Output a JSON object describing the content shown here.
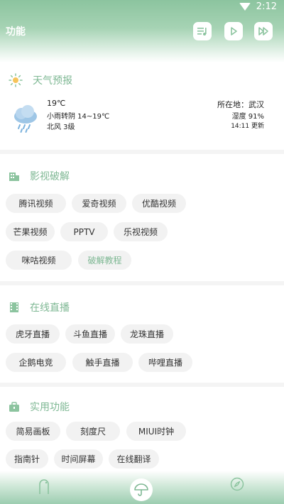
{
  "status": {
    "time": "2:12"
  },
  "header": {
    "title": "功能"
  },
  "weather": {
    "section_title": "天气预报",
    "temperature": "19℃",
    "description": "小雨转阴 14~19℃",
    "wind": "北风 3级",
    "location": "所在地：武汉",
    "humidity": "湿度 91%",
    "updated": "14:11 更新"
  },
  "video": {
    "section_title": "影视破解",
    "items": [
      "腾讯视频",
      "爱奇视频",
      "优酷视频",
      "芒果视频",
      "PPTV",
      "乐视视频",
      "咪咕视频",
      "破解教程"
    ]
  },
  "live": {
    "section_title": "在线直播",
    "items": [
      "虎牙直播",
      "斗鱼直播",
      "龙珠直播",
      "企鹅电竞",
      "触手直播",
      "哔哩直播"
    ]
  },
  "utility": {
    "section_title": "实用功能",
    "items": [
      "简易画板",
      "刻度尺",
      "MIUI时钟",
      "指南针",
      "时间屏幕",
      "在线翻译"
    ]
  },
  "colors": {
    "accent": "#7fb894",
    "header_green": "#8cc49f",
    "chip_bg": "#f2f2f2"
  }
}
